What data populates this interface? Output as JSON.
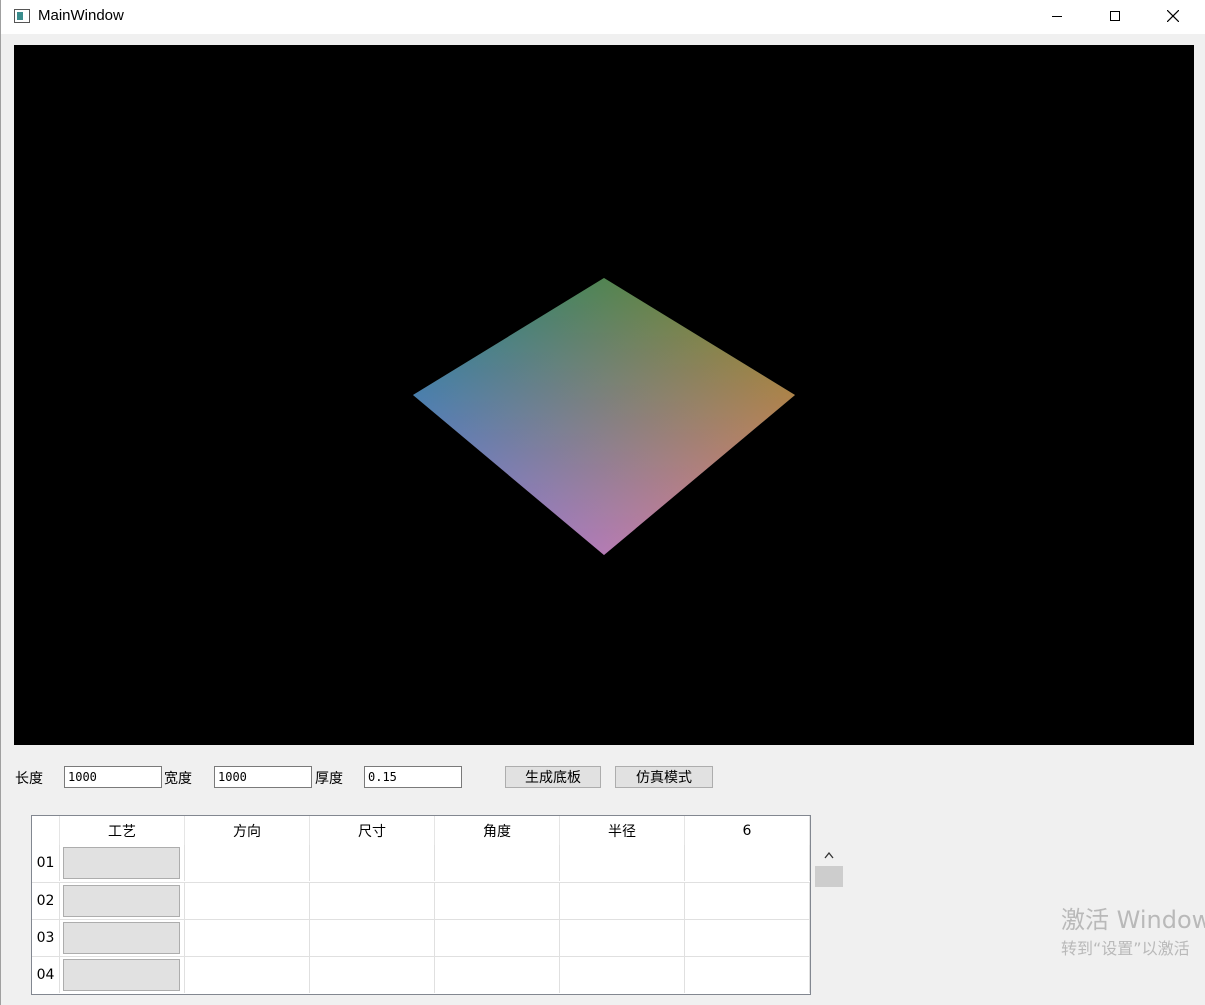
{
  "window": {
    "title": "MainWindow",
    "minimize_label": "—",
    "maximize_label": "☐",
    "close_label": "✕"
  },
  "viewport": {
    "background": "#000000",
    "shape_colors": {
      "top": "#228b22",
      "left": "#1e7ae6",
      "right": "#e6821e",
      "bottom": "#e67ae6"
    }
  },
  "params": {
    "length_label": "长度",
    "length_value": "1000",
    "width_label": "宽度",
    "width_value": "1000",
    "thickness_label": "厚度",
    "thickness_value": "0.15",
    "generate_button": "生成底板",
    "simulate_button": "仿真模式"
  },
  "table": {
    "headers": [
      "工艺",
      "方向",
      "尺寸",
      "角度",
      "半径",
      "6"
    ],
    "rows": [
      "01",
      "02",
      "03",
      "04"
    ]
  },
  "scroll": {
    "up_icon": "^"
  },
  "watermark": {
    "line1": "激活 Windows",
    "line2": "转到“设置”以激活"
  }
}
